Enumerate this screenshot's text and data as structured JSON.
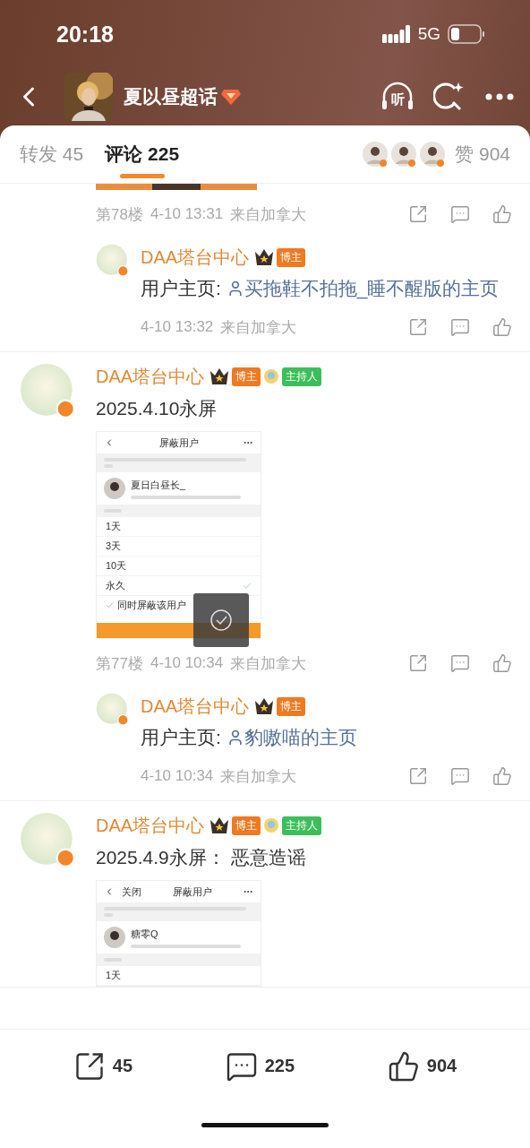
{
  "status_bar": {
    "time": "20:18",
    "network": "5G"
  },
  "header": {
    "title": "夏以昼超话",
    "listen_label": "听"
  },
  "tabs": [
    {
      "label": "转发",
      "count": "45",
      "selected": false
    },
    {
      "label": "评论",
      "count": "225",
      "selected": true
    }
  ],
  "likes": {
    "label": "赞",
    "count": "904"
  },
  "comments": [
    {
      "screenshot": {
        "kind": "tail"
      },
      "floor": "第78楼",
      "time": "4-10 13:31",
      "location": "来自加拿大",
      "replies": [
        {
          "author": "DAA塔台中心",
          "badges": [
            {
              "kind": "blogger",
              "label": "博主"
            }
          ],
          "prefix": "用户主页:",
          "link": "买拖鞋不拍拖_睡不醒版的主页",
          "time": "4-10 13:32",
          "location": "来自加拿大"
        }
      ]
    },
    {
      "author": "DAA塔台中心",
      "badges": [
        {
          "kind": "blogger",
          "label": "博主"
        },
        {
          "kind": "host",
          "label": "主持人"
        }
      ],
      "text": "2025.4.10永屏",
      "screenshot": {
        "kind": "block-user",
        "title": "屏蔽用户",
        "user": "夏日白昼长_",
        "options": [
          {
            "label": "1天",
            "selected": false
          },
          {
            "label": "3天",
            "selected": false
          },
          {
            "label": "10天",
            "selected": false
          },
          {
            "label": "永久",
            "selected": true
          }
        ],
        "checkbox": {
          "label": "同时屏蔽该用户",
          "checked": true
        },
        "toast": true
      },
      "floor": "第77楼",
      "time": "4-10 10:34",
      "location": "来自加拿大",
      "replies": [
        {
          "author": "DAA塔台中心",
          "badges": [
            {
              "kind": "blogger",
              "label": "博主"
            }
          ],
          "prefix": "用户主页:",
          "link": "豹嗷喵的主页",
          "time": "4-10 10:34",
          "location": "来自加拿大"
        }
      ]
    },
    {
      "author": "DAA塔台中心",
      "badges": [
        {
          "kind": "blogger",
          "label": "博主"
        },
        {
          "kind": "host",
          "label": "主持人"
        }
      ],
      "text": "2025.4.9永屏：  恶意造谣",
      "screenshot": {
        "kind": "block-user",
        "nav_left": "关闭",
        "title": "屏蔽用户",
        "user": "糖零Q",
        "options": [
          {
            "label": "1天",
            "selected": false
          }
        ]
      }
    }
  ],
  "bottom_bar": [
    {
      "kind": "repost",
      "count": "45"
    },
    {
      "kind": "comment",
      "count": "225"
    },
    {
      "kind": "like",
      "count": "904"
    }
  ]
}
